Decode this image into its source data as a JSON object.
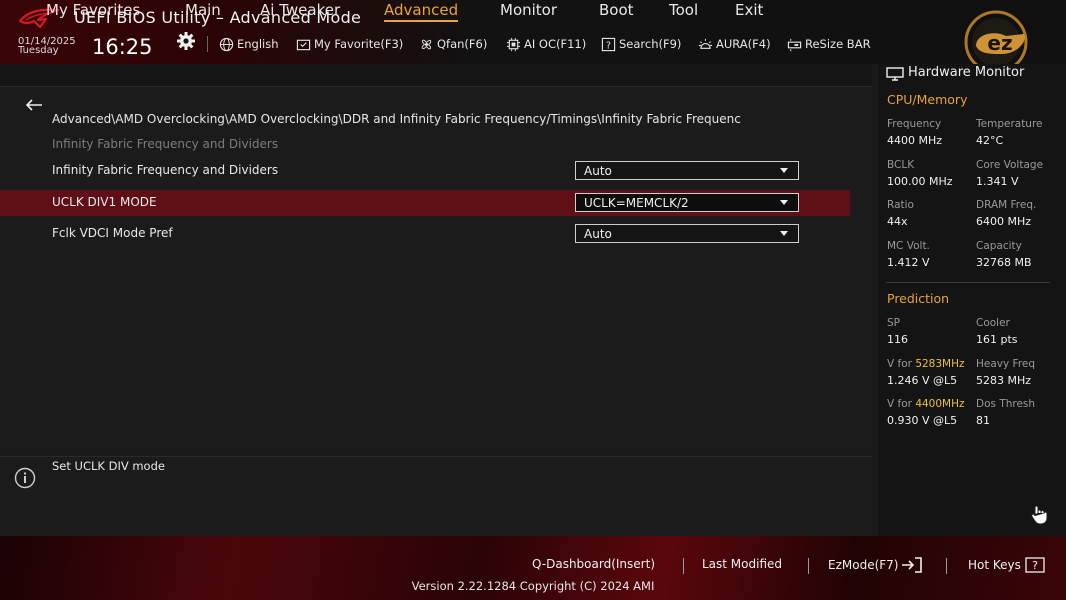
{
  "header": {
    "title": "UEFI BIOS Utility – Advanced Mode",
    "date": "01/14/2025",
    "weekday": "Tuesday",
    "time": "16:25",
    "tools": [
      {
        "label": "English",
        "icon": "globe-icon"
      },
      {
        "label": "My Favorite(F3)",
        "icon": "favorite-folder-icon"
      },
      {
        "label": "Qfan(F6)",
        "icon": "fan-icon"
      },
      {
        "label": "AI OC(F11)",
        "icon": "ai-chip-icon"
      },
      {
        "label": "Search(F9)",
        "icon": "search-icon"
      },
      {
        "label": "AURA(F4)",
        "icon": "aura-light-icon"
      },
      {
        "label": "ReSize BAR",
        "icon": "resize-bar-icon"
      }
    ]
  },
  "menu": {
    "tabs": [
      "My Favorites",
      "Main",
      "Ai Tweaker",
      "Advanced",
      "Monitor",
      "Boot",
      "Tool",
      "Exit"
    ],
    "active": "Advanced"
  },
  "main": {
    "breadcrumb": "Advanced\\AMD Overclocking\\AMD Overclocking\\DDR and Infinity Fabric Frequency/Timings\\Infinity Fabric Frequenc",
    "section_title": "Infinity Fabric Frequency and Dividers",
    "settings": [
      {
        "label": "Infinity Fabric Frequency and Dividers",
        "value": "Auto"
      },
      {
        "label": "UCLK DIV1 MODE",
        "value": "UCLK=MEMCLK/2"
      },
      {
        "label": "Fclk VDCI Mode Pref",
        "value": "Auto"
      }
    ]
  },
  "help": {
    "text": "Set UCLK DIV mode"
  },
  "hw_monitor": {
    "title": "Hardware Monitor",
    "cpu_memory": {
      "heading": "CPU/Memory",
      "items": [
        {
          "label": "Frequency",
          "value": "4400 MHz"
        },
        {
          "label": "Temperature",
          "value": "42°C"
        },
        {
          "label": "BCLK",
          "value": "100.00 MHz"
        },
        {
          "label": "Core Voltage",
          "value": "1.341 V"
        },
        {
          "label": "Ratio",
          "value": "44x"
        },
        {
          "label": "DRAM Freq.",
          "value": "6400 MHz"
        },
        {
          "label": "MC Volt.",
          "value": "1.412 V"
        },
        {
          "label": "Capacity",
          "value": "32768 MB"
        }
      ]
    },
    "prediction": {
      "heading": "Prediction",
      "sp_label": "SP",
      "sp_value": "116",
      "cooler_label": "Cooler",
      "cooler_value": "161 pts",
      "v_for_prefix": "V for",
      "v_for_1_freq": "5283MHz",
      "v_for_1_value": "1.246 V @L5",
      "heavy_freq_label": "Heavy Freq",
      "heavy_freq_value": "5283 MHz",
      "v_for_2_freq": "4400MHz",
      "v_for_2_value": "0.930 V @L5",
      "dos_thresh_label": "Dos Thresh",
      "dos_thresh_value": "81"
    }
  },
  "footer": {
    "q_dashboard": "Q-Dashboard(Insert)",
    "last_modified": "Last Modified",
    "ezmode": "EzMode(F7)",
    "hot_keys": "Hot Keys",
    "version": "Version 2.22.1284 Copyright (C) 2024 AMI"
  },
  "colors": {
    "accent_orange": "#e8a33c",
    "highlight_yellow": "#e8c23c",
    "selected_row": "#5e1016",
    "brand_red": "#c8101c"
  }
}
